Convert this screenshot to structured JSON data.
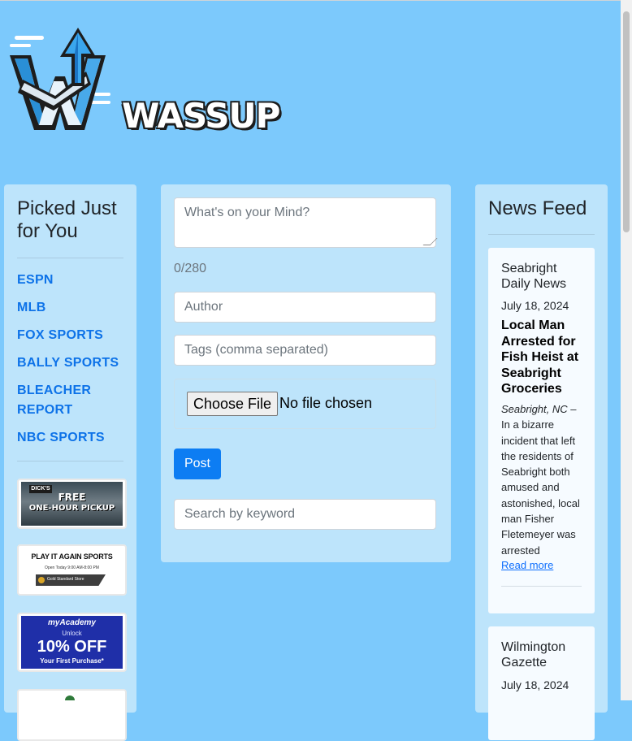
{
  "brand": {
    "name": "WASSUP"
  },
  "left": {
    "title": "Picked Just for You",
    "links": [
      "ESPN",
      "MLB",
      "FOX SPORTS",
      "BALLY SPORTS",
      "BLEACHER REPORT",
      "NBC SPORTS"
    ],
    "ads": [
      {
        "line1": "FREE",
        "line2": "ONE-HOUR PICKUP",
        "sign": "DICK'S"
      },
      {
        "title": "PLAY IT AGAIN SPORTS",
        "hours": "Open Today 9:00 AM-8:00 PM",
        "pill": "Gold Standard Store"
      },
      {
        "brand": "myAcademy",
        "line1": "Unlock",
        "big": "10% OFF",
        "line2": "Your First Purchase*"
      }
    ]
  },
  "compose": {
    "textarea_placeholder": "What's on your Mind?",
    "counter": "0/280",
    "author_placeholder": "Author",
    "tags_placeholder": "Tags (comma separated)",
    "file_button": "Choose File",
    "file_status": "No file chosen",
    "post_label": "Post",
    "search_placeholder": "Search by keyword"
  },
  "news": {
    "title": "News Feed",
    "cards": [
      {
        "source": "Seabright Daily News",
        "date": "July 18, 2024",
        "headline": "Local Man Arrested for Fish Heist at Seabright Groceries",
        "location": "Seabright, NC",
        "body": " – In a bizarre incident that left the residents of Seabright both amused and astonished, local man Fisher Fletemeyer was arrested",
        "link": "Read more"
      },
      {
        "source": "Wilmington Gazette",
        "date": "July 18, 2024"
      }
    ]
  },
  "colors": {
    "background": "#7cc9fc",
    "panel": "#bde4fb",
    "link": "#0d72e8",
    "primary_button": "#0d7df3"
  }
}
